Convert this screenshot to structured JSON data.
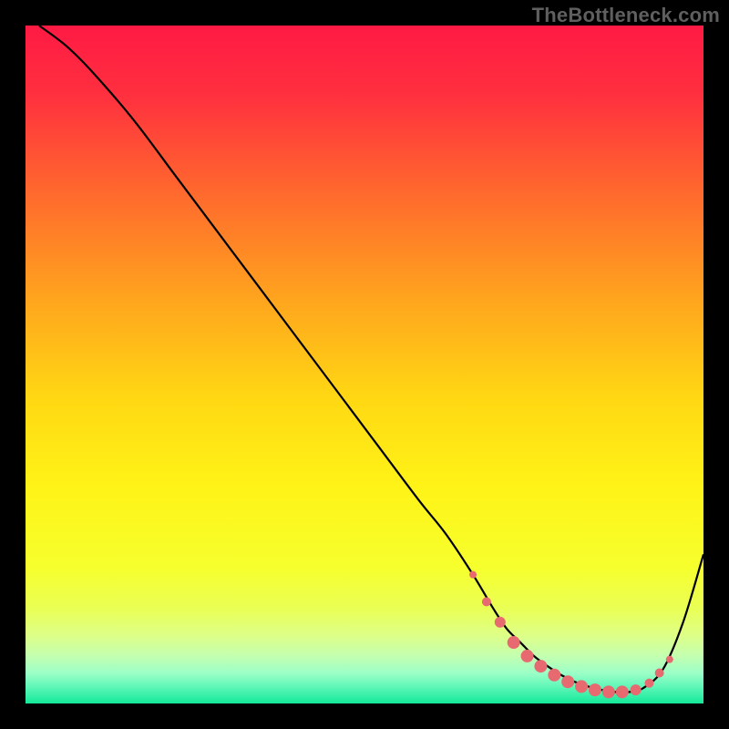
{
  "watermark": "TheBottleneck.com",
  "chart_data": {
    "type": "line",
    "title": "",
    "xlabel": "",
    "ylabel": "",
    "xlim": [
      0,
      100
    ],
    "ylim": [
      0,
      100
    ],
    "background_gradient": {
      "stops": [
        {
          "offset": 0.0,
          "color": "#ff1a44"
        },
        {
          "offset": 0.1,
          "color": "#ff2f3f"
        },
        {
          "offset": 0.25,
          "color": "#ff6a2d"
        },
        {
          "offset": 0.4,
          "color": "#ffa31e"
        },
        {
          "offset": 0.55,
          "color": "#ffd813"
        },
        {
          "offset": 0.68,
          "color": "#fff317"
        },
        {
          "offset": 0.8,
          "color": "#f6ff2d"
        },
        {
          "offset": 0.86,
          "color": "#eaff55"
        },
        {
          "offset": 0.9,
          "color": "#ddff88"
        },
        {
          "offset": 0.93,
          "color": "#c4ffb0"
        },
        {
          "offset": 0.955,
          "color": "#9cffc7"
        },
        {
          "offset": 0.975,
          "color": "#60f7b8"
        },
        {
          "offset": 1.0,
          "color": "#14e89a"
        }
      ]
    },
    "series": [
      {
        "name": "bottleneck-curve",
        "color": "#000000",
        "x": [
          2,
          6,
          10,
          16,
          22,
          28,
          34,
          40,
          46,
          52,
          58,
          62,
          66,
          69,
          71,
          73,
          75,
          77,
          79,
          81,
          83,
          85,
          87,
          89,
          91,
          94,
          97,
          100
        ],
        "y": [
          100,
          97,
          93,
          86,
          78,
          70,
          62,
          54,
          46,
          38,
          30,
          25,
          19,
          14,
          11,
          9,
          7,
          5.5,
          4.2,
          3.2,
          2.5,
          2.0,
          1.7,
          1.7,
          2.2,
          5,
          12,
          22
        ]
      }
    ],
    "markers": {
      "name": "highlighted-range",
      "color": "#e66a6f",
      "points": [
        {
          "x": 66,
          "y": 19,
          "r": 4
        },
        {
          "x": 68,
          "y": 15,
          "r": 5
        },
        {
          "x": 70,
          "y": 12,
          "r": 6
        },
        {
          "x": 72,
          "y": 9,
          "r": 7
        },
        {
          "x": 74,
          "y": 7,
          "r": 7
        },
        {
          "x": 76,
          "y": 5.5,
          "r": 7
        },
        {
          "x": 78,
          "y": 4.2,
          "r": 7
        },
        {
          "x": 80,
          "y": 3.2,
          "r": 7
        },
        {
          "x": 82,
          "y": 2.5,
          "r": 7
        },
        {
          "x": 84,
          "y": 2.0,
          "r": 7
        },
        {
          "x": 86,
          "y": 1.7,
          "r": 7
        },
        {
          "x": 88,
          "y": 1.7,
          "r": 7
        },
        {
          "x": 90,
          "y": 2.0,
          "r": 6
        },
        {
          "x": 92,
          "y": 3.0,
          "r": 5
        },
        {
          "x": 93.5,
          "y": 4.5,
          "r": 5
        },
        {
          "x": 95,
          "y": 6.5,
          "r": 4
        }
      ]
    }
  }
}
